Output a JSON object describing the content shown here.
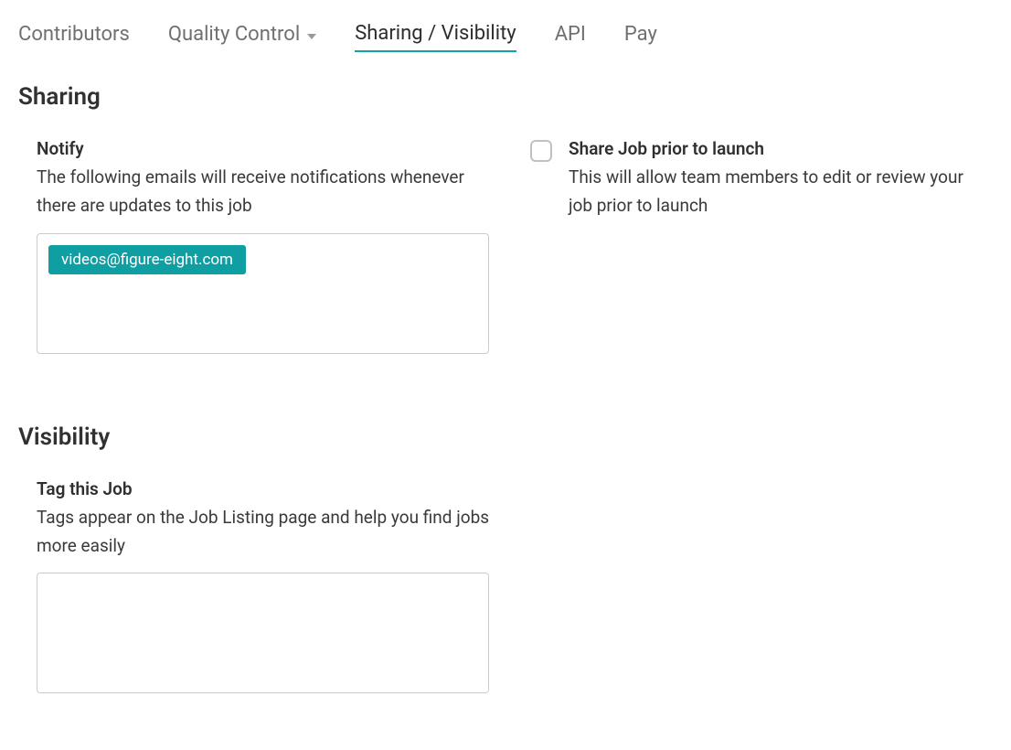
{
  "tabs": {
    "contributors": "Contributors",
    "quality_control": "Quality Control",
    "sharing_visibility": "Sharing / Visibility",
    "api": "API",
    "pay": "Pay",
    "active": "sharing_visibility"
  },
  "sharing": {
    "heading": "Sharing",
    "notify": {
      "title": "Notify",
      "desc": "The following emails will receive notifications whenever there are updates to this job",
      "emails": [
        "videos@figure-eight.com"
      ]
    },
    "share_prior": {
      "title": "Share Job prior to launch",
      "desc": "This will allow team members to edit or review your job prior to launch",
      "checked": false
    }
  },
  "visibility": {
    "heading": "Visibility",
    "tag": {
      "title": "Tag this Job",
      "desc": "Tags appear on the Job Listing page and help you find jobs more easily",
      "tags": []
    }
  }
}
